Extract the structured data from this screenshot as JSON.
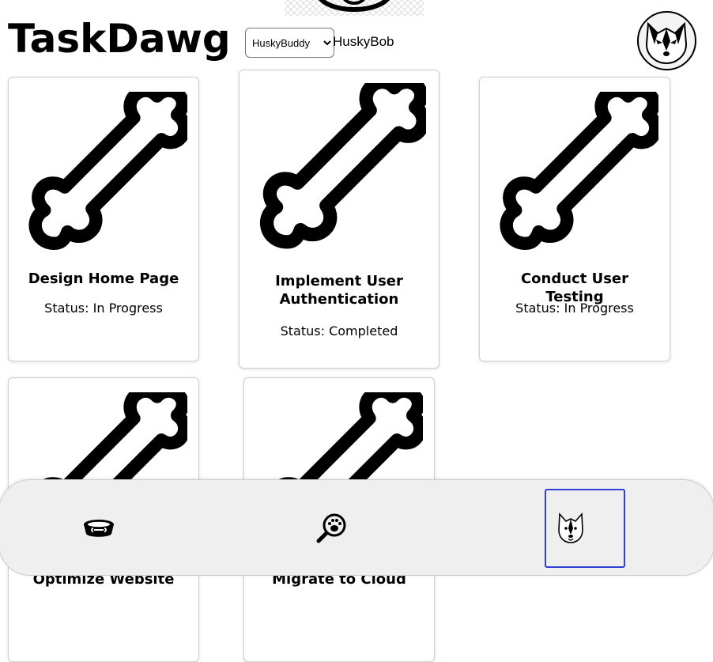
{
  "app": {
    "title": "TaskDawg"
  },
  "user_select": {
    "selected": "HuskyBuddy",
    "options": [
      "HuskyBuddy"
    ]
  },
  "user_name": "HuskyBob",
  "tasks": [
    {
      "title": "Design Home Page",
      "status": "Status: In Progress",
      "icon": "bone-icon"
    },
    {
      "title": "Implement User Authentication",
      "status": "Status: Completed",
      "icon": "bone-icon"
    },
    {
      "title": "Conduct User Testing",
      "status": "Status: In Progress",
      "icon": "bone-icon"
    },
    {
      "title": "Optimize Website",
      "status": "",
      "icon": "bone-icon"
    },
    {
      "title": "Migrate to Cloud",
      "status": "",
      "icon": "bone-icon"
    }
  ],
  "nav": {
    "items": [
      {
        "icon": "dog-bowl-icon",
        "active": false
      },
      {
        "icon": "paw-search-icon",
        "active": false
      },
      {
        "icon": "husky-icon",
        "active": true
      }
    ],
    "active_color": "#2f3fd8"
  }
}
